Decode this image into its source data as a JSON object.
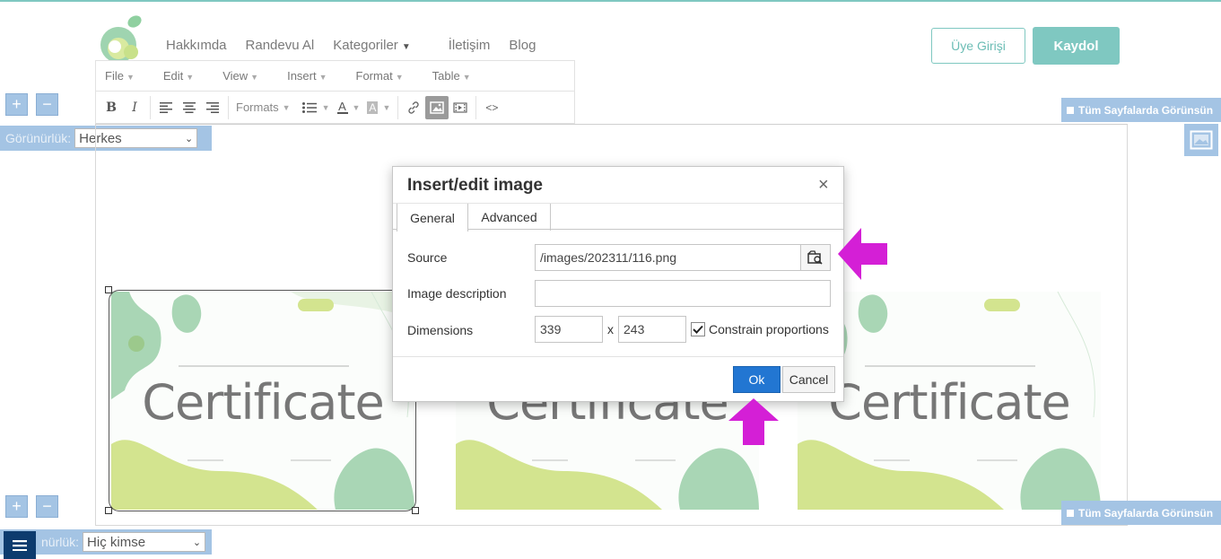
{
  "header": {
    "nav": [
      {
        "label": "Hakkımda"
      },
      {
        "label": "Randevu Al"
      },
      {
        "label": "Kategoriler"
      },
      {
        "label": "İletişim"
      },
      {
        "label": "Blog"
      }
    ],
    "login_label": "Üye Girişi",
    "register_label": "Kaydol"
  },
  "editor": {
    "menubar": [
      "File",
      "Edit",
      "View",
      "Insert",
      "Format",
      "Table"
    ],
    "toolbar": {
      "bold": "B",
      "italic": "I",
      "formats": "Formats",
      "font_color": "A",
      "bg_color": "A",
      "code": "<>"
    }
  },
  "builder": {
    "plus": "+",
    "minus": "−",
    "visibility_label": "Görünürlük:",
    "visibility_label_partial": "nürlük:",
    "visibility_top": "Herkes",
    "visibility_bottom": "Hiç kimse",
    "all_pages": "Tüm Sayfalarda Görünsün"
  },
  "content": {
    "certificate_text": "Certificate",
    "cert_badge": "▸▸▸"
  },
  "dialog": {
    "title": "Insert/edit image",
    "close": "×",
    "tabs": [
      "General",
      "Advanced"
    ],
    "source_label": "Source",
    "source_value": "/images/202311/116.png",
    "description_label": "Image description",
    "description_value": "",
    "dimensions_label": "Dimensions",
    "width": "339",
    "height": "243",
    "x_sep": "x",
    "constrain_label": "Constrain proportions",
    "ok": "Ok",
    "cancel": "Cancel"
  },
  "colors": {
    "brand_teal": "#7fc8c1",
    "builder_blue": "#a4c4e4",
    "ok_blue": "#2276d2",
    "arrow_magenta": "#d41fd6",
    "cert_green": "#a9d6b5",
    "cert_lime": "#d3e48f"
  },
  "icons": {
    "browse": "image-browse-icon",
    "menu": "hamburger-icon",
    "image_tool": "image-icon"
  }
}
